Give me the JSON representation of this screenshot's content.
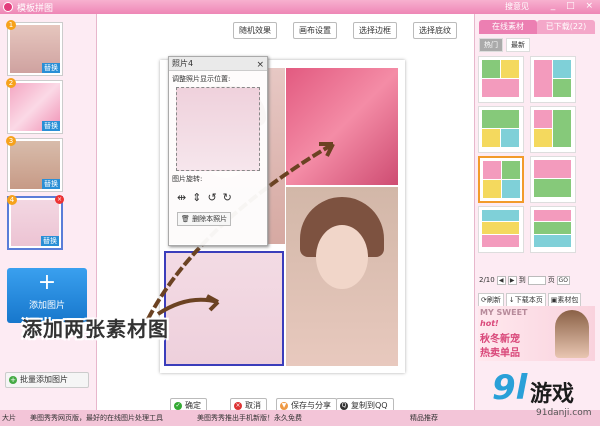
{
  "titlebar": {
    "title": "模板拼图",
    "link": "搜意见",
    "controls": "_ □ ×"
  },
  "thumbs": [
    {
      "badge": "1",
      "swap": "替换"
    },
    {
      "badge": "2",
      "swap": "替换"
    },
    {
      "badge": "3",
      "swap": "替换"
    },
    {
      "badge": "4",
      "swap": "替换"
    }
  ],
  "add_pic": {
    "plus": "+",
    "label": "添加图片"
  },
  "batch": {
    "label": "批量添加图片"
  },
  "toolbar": {
    "random": "随机效果",
    "layout": "画布设置",
    "border": "选择边框",
    "texture": "选择底纹"
  },
  "popup": {
    "title": "照片4",
    "close": "×",
    "pos_label": "调整照片显示位置:",
    "rotate_label": "图片旋转:",
    "delete": "删除本照片"
  },
  "bottom": {
    "ok": "确定",
    "cancel": "取消",
    "save": "保存与分享",
    "copy": "复制到QQ"
  },
  "right": {
    "tab_online": "在线素材",
    "tab_downloaded": "已下载(22)",
    "sub_hot": "热门",
    "sub_new": "最新",
    "page": "2/10",
    "to": "到",
    "page_unit": "页",
    "go": "GO",
    "refresh": "刷新",
    "download": "下载本页",
    "library": "素材包",
    "ad_line1": "MY SWEET",
    "ad_line2": "hot!",
    "ad_line3": "秋冬新宠",
    "ad_line4": "热卖单品"
  },
  "status": {
    "s1": "大片",
    "s2": "美图秀秀网页版，最好的在线图片处理工具",
    "s3": "美图秀秀推出手机新版！永久免费",
    "s4": "精品推荐"
  },
  "caption": "添加两张素材图",
  "watermark": {
    "logo": "9l",
    "game": "游戏",
    "url": "91danji.com"
  }
}
